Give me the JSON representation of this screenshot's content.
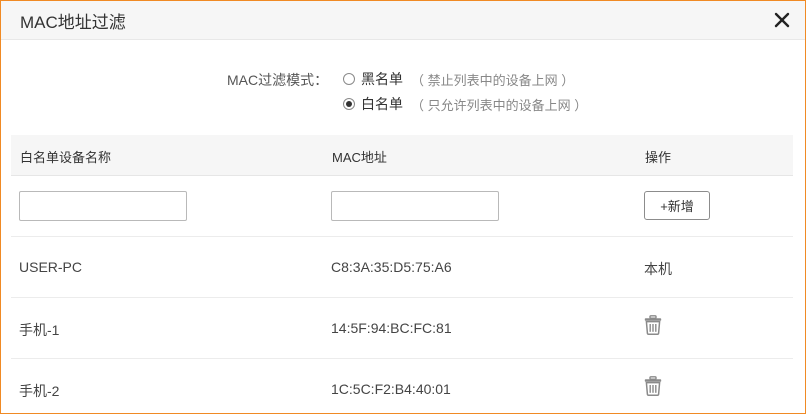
{
  "dialog": {
    "title": "MAC地址过滤",
    "close_icon": "close-icon"
  },
  "filter_mode": {
    "label": "MAC过滤模式：",
    "options": [
      {
        "label": "黑名单",
        "hint": "（ 禁止列表中的设备上网 ）",
        "selected": false
      },
      {
        "label": "白名单",
        "hint": "（ 只允许列表中的设备上网 ）",
        "selected": true
      }
    ]
  },
  "table": {
    "headers": [
      "白名单设备名称",
      "MAC地址",
      "操作"
    ],
    "new_entry": {
      "name_value": "",
      "mac_value": "",
      "add_button_label": "+新增"
    },
    "rows": [
      {
        "name": "USER-PC",
        "mac": "C8:3A:35:D5:75:A6",
        "action": "本机",
        "action_icon": ""
      },
      {
        "name": "手机-1",
        "mac": "14:5F:94:BC:FC:81",
        "action": "",
        "action_icon": "trash-icon"
      },
      {
        "name": "手机-2",
        "mac": "1C:5C:F2:B4:40:01",
        "action": "",
        "action_icon": "trash-icon"
      }
    ]
  },
  "colors": {
    "border_accent": "#f08a24",
    "header_bg": "#f6f6f6",
    "text": "#333333",
    "hint": "#888888",
    "icon": "#8a8a8a"
  }
}
